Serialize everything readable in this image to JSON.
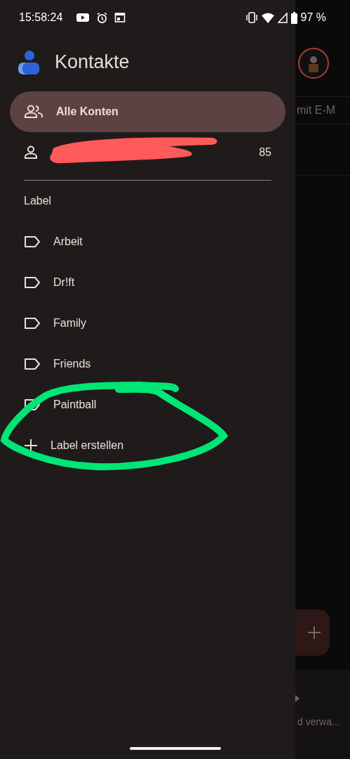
{
  "status_bar": {
    "time": "15:58:24",
    "battery": "97 %"
  },
  "drawer": {
    "title": "Kontakte",
    "accounts": [
      {
        "kind": "all",
        "label": "Alle Konten",
        "selected": true
      },
      {
        "kind": "account",
        "count": "85",
        "selected": false,
        "redacted": true
      }
    ],
    "labels_heading": "Label",
    "labels": [
      {
        "label": "Arbeit"
      },
      {
        "label": "Dr!ft"
      },
      {
        "label": "Family"
      },
      {
        "label": "Friends"
      },
      {
        "label": "Paintball"
      }
    ],
    "create_label": "Label erstellen"
  },
  "annotation": {
    "kind": "ellipse"
  },
  "background_app": {
    "search_text": "mit E-M",
    "bottom_text": "d verwa..."
  }
}
